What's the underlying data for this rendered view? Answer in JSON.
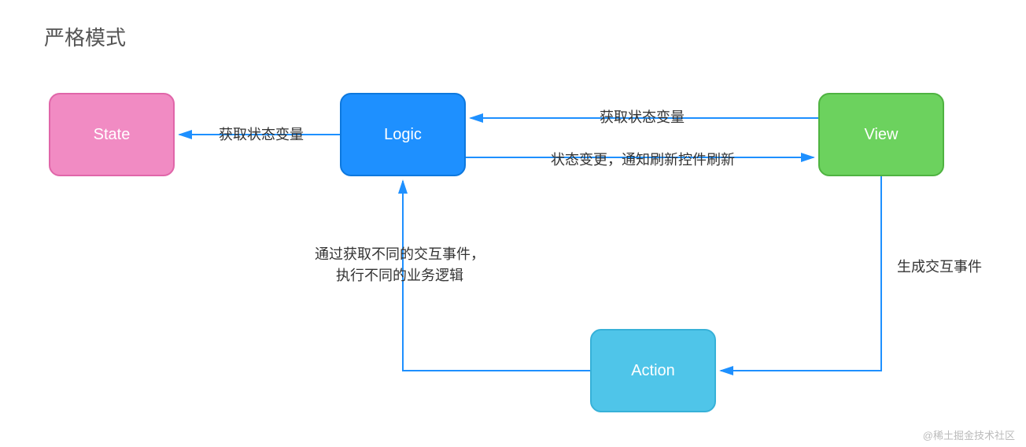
{
  "title": "严格模式",
  "nodes": {
    "state": {
      "label": "State"
    },
    "logic": {
      "label": "Logic"
    },
    "view": {
      "label": "View"
    },
    "action": {
      "label": "Action"
    }
  },
  "edges": {
    "logic_to_state": {
      "label": "获取状态变量"
    },
    "view_to_logic": {
      "label": "获取状态变量"
    },
    "logic_to_view": {
      "label": "状态变更，通知刷新控件刷新"
    },
    "view_to_action": {
      "label": "生成交互事件"
    },
    "action_to_logic": {
      "label_line1": "通过获取不同的交互事件，",
      "label_line2": "执行不同的业务逻辑"
    }
  },
  "watermark": "@稀土掘金技术社区",
  "colors": {
    "arrow": "#1e90ff"
  }
}
